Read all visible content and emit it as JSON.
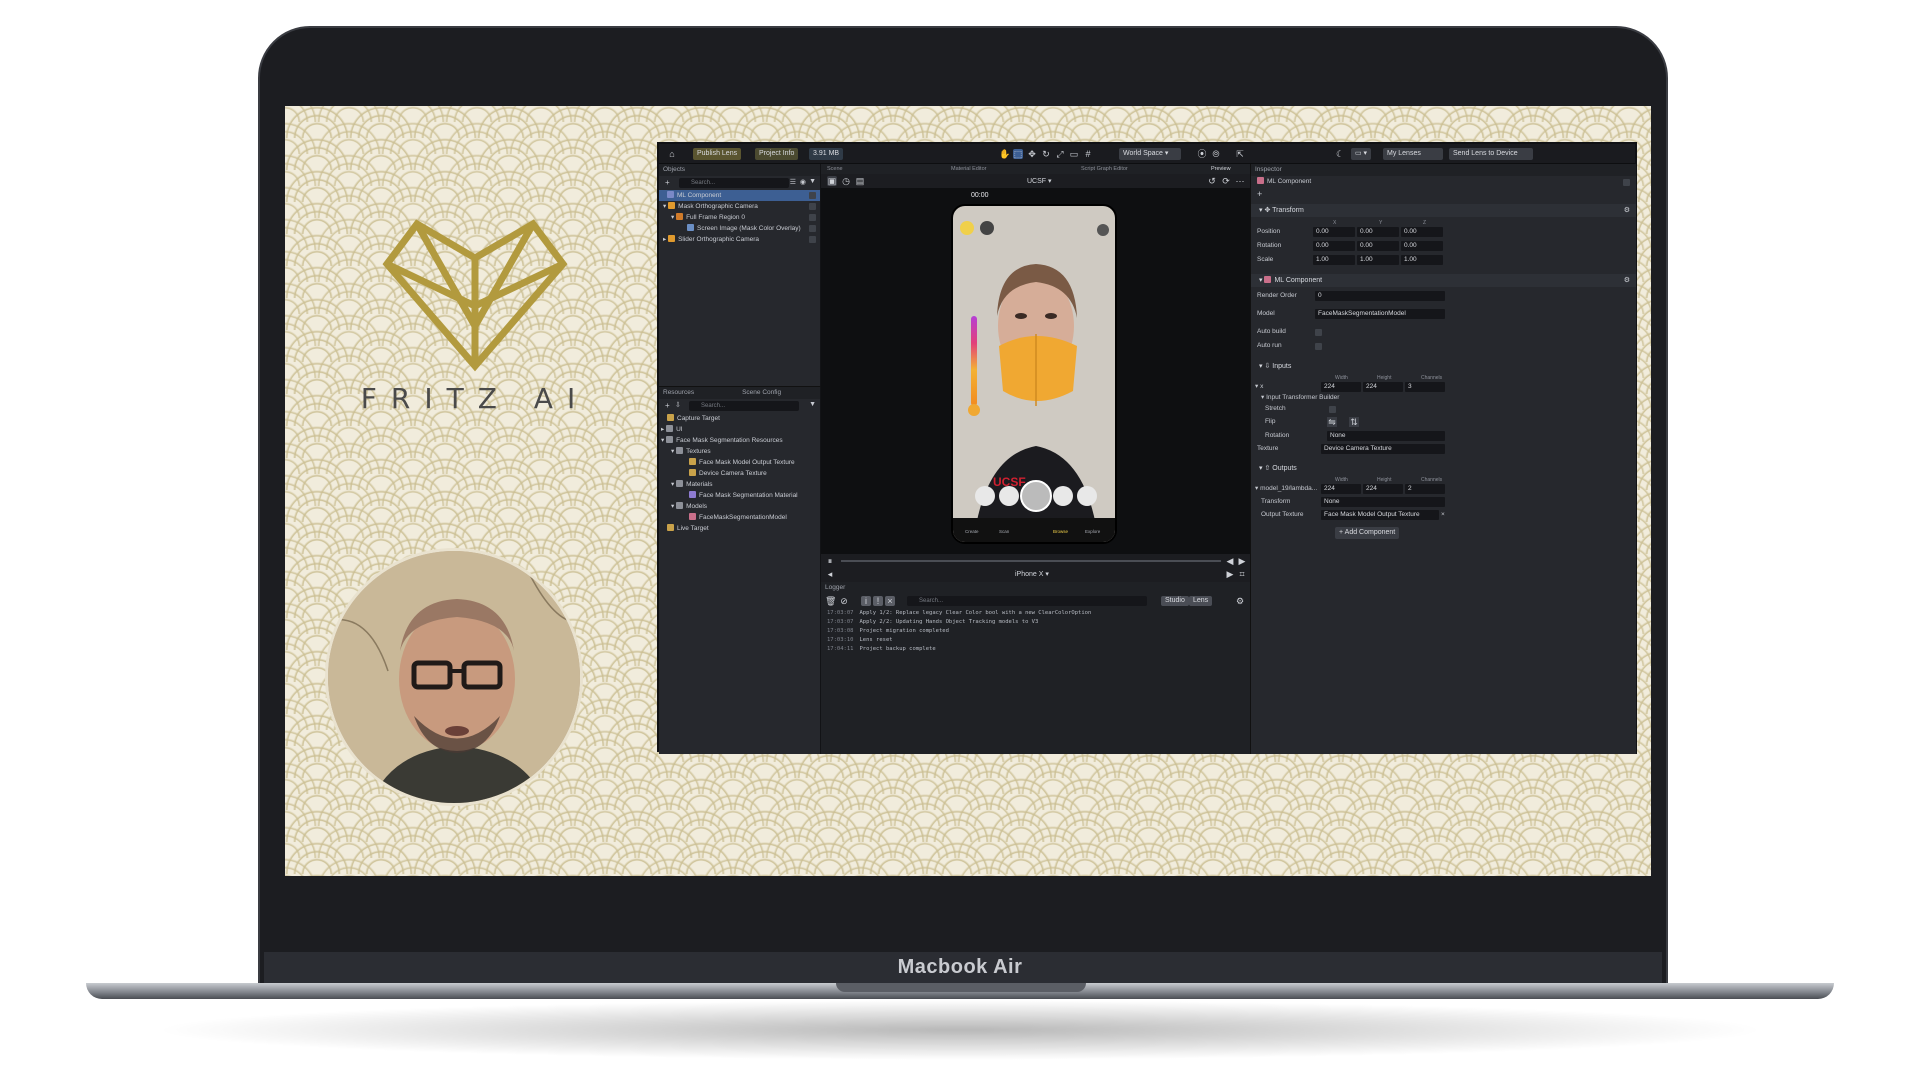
{
  "device": {
    "brand": "Macbook Air"
  },
  "slide": {
    "logo_text": "FRITZ AI"
  },
  "topbar": {
    "publish": "Publish Lens",
    "project_info": "Project Info",
    "size": "3.91 MB",
    "world_space": "World Space",
    "my_lenses": "My Lenses",
    "send_to_device": "Send Lens to Device"
  },
  "objects": {
    "title": "Objects",
    "search_placeholder": "Search...",
    "items": [
      {
        "label": "ML Component",
        "selected": true
      },
      {
        "label": "Mask Orthographic Camera"
      },
      {
        "label": "Full Frame Region 0"
      },
      {
        "label": "Screen Image (Mask Color Overlay)"
      },
      {
        "label": "Slider Orthographic Camera"
      }
    ]
  },
  "resources": {
    "title": "Resources",
    "tab2": "Scene Config",
    "search_placeholder": "Search...",
    "items": [
      {
        "label": "Capture Target"
      },
      {
        "label": "UI"
      },
      {
        "label": "Face Mask Segmentation Resources"
      },
      {
        "label": "Textures"
      },
      {
        "label": "Face Mask Model Output Texture"
      },
      {
        "label": "Device Camera Texture"
      },
      {
        "label": "Materials"
      },
      {
        "label": "Face Mask Segmentation Material"
      },
      {
        "label": "Models"
      },
      {
        "label": "FaceMaskSegmentationModel"
      },
      {
        "label": "Live Target"
      }
    ]
  },
  "center": {
    "tabs": {
      "scene": "Scene",
      "material_editor": "Material Editor",
      "script_graph": "Script Graph Editor",
      "preview": "Preview"
    },
    "preview_source": "UCSF",
    "timer": "00:00",
    "shirt_text": "UCSF",
    "device": "iPhone X",
    "bottom_icons": [
      "Create",
      "Scan",
      "",
      "Browse",
      "Explore"
    ]
  },
  "logger": {
    "title": "Logger",
    "search_placeholder": "Search...",
    "filter_studio": "Studio",
    "filter_lens": "Lens",
    "lines": [
      {
        "time": "17:03:07",
        "text": "Apply 1/2: Replace legacy Clear Color bool with a new ClearColorOption"
      },
      {
        "time": "17:03:07",
        "text": "Apply 2/2: Updating Hands Object Tracking models to V3"
      },
      {
        "time": "17:03:08",
        "text": "Project migration completed"
      },
      {
        "time": "17:03:10",
        "text": "Lens reset"
      },
      {
        "time": "17:04:11",
        "text": "Project backup complete"
      }
    ]
  },
  "inspector": {
    "title": "Inspector",
    "object_name": "ML Component",
    "transform": {
      "title": "Transform",
      "axes": [
        "X",
        "Y",
        "Z"
      ],
      "rows": [
        {
          "label": "Position",
          "values": [
            "0.00",
            "0.00",
            "0.00"
          ]
        },
        {
          "label": "Rotation",
          "values": [
            "0.00",
            "0.00",
            "0.00"
          ]
        },
        {
          "label": "Scale",
          "values": [
            "1.00",
            "1.00",
            "1.00"
          ]
        }
      ]
    },
    "ml": {
      "title": "ML Component",
      "render_order_label": "Render Order",
      "render_order": "0",
      "model_label": "Model",
      "model": "FaceMaskSegmentationModel",
      "auto_build": "Auto build",
      "auto_run": "Auto run"
    },
    "inputs": {
      "title": "Inputs",
      "cols": [
        "Width",
        "Height",
        "Channels"
      ],
      "name": "x",
      "values": [
        "224",
        "224",
        "3"
      ],
      "builder": "Input Transformer Builder",
      "stretch": "Stretch",
      "flip": "Flip",
      "rotation_label": "Rotation",
      "rotation": "None",
      "texture_label": "Texture",
      "texture": "Device Camera Texture"
    },
    "outputs": {
      "title": "Outputs",
      "cols": [
        "Width",
        "Height",
        "Channels"
      ],
      "name": "model_19/lambda...",
      "values": [
        "224",
        "224",
        "2"
      ],
      "transform_label": "Transform",
      "transform": "None",
      "texture_label": "Output Texture",
      "texture": "Face Mask Model Output Texture"
    },
    "add_component": "Add Component"
  }
}
